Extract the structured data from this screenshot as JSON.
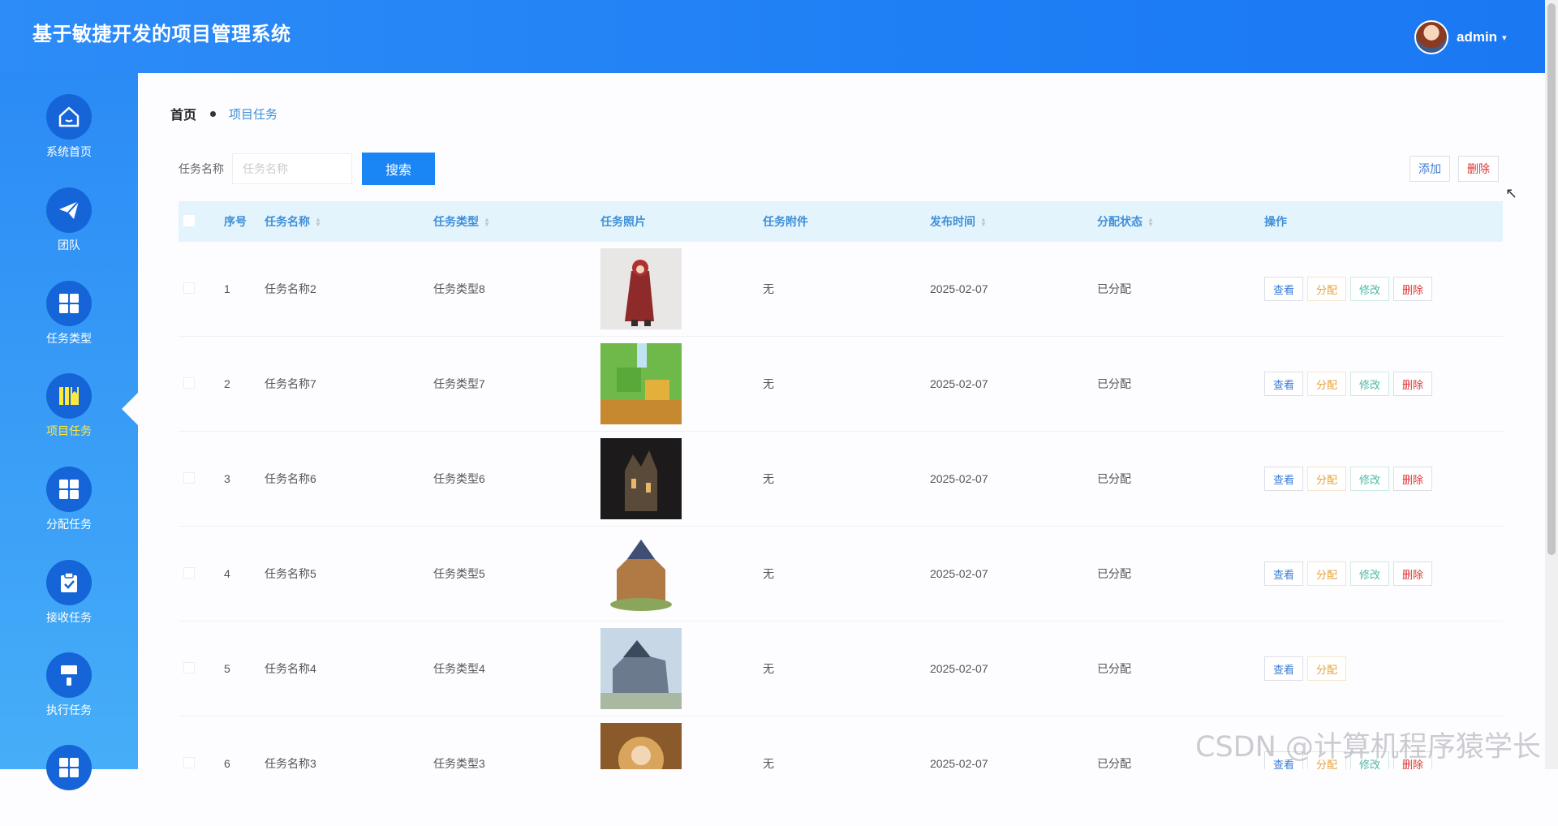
{
  "header": {
    "title": "基于敏捷开发的项目管理系统",
    "username": "admin",
    "caret": "▾"
  },
  "sidebar": {
    "items": [
      {
        "label": "系统首页",
        "icon": "home-icon"
      },
      {
        "label": "团队",
        "icon": "paper-plane-icon"
      },
      {
        "label": "任务类型",
        "icon": "grid-icon"
      },
      {
        "label": "项目任务",
        "icon": "book-icon",
        "active": true
      },
      {
        "label": "分配任务",
        "icon": "grid-icon"
      },
      {
        "label": "接收任务",
        "icon": "clipboard-check-icon"
      },
      {
        "label": "执行任务",
        "icon": "brush-icon"
      },
      {
        "label": "",
        "icon": "grid-icon"
      }
    ]
  },
  "breadcrumb": {
    "home": "首页",
    "current": "项目任务"
  },
  "search": {
    "label": "任务名称",
    "placeholder": "任务名称",
    "button": "搜索"
  },
  "toolbar": {
    "add_label": "添加",
    "delete_label": "删除"
  },
  "table": {
    "headers": {
      "index": "序号",
      "name": "任务名称",
      "type": "任务类型",
      "photo": "任务照片",
      "attachment": "任务附件",
      "publish_time": "发布时间",
      "status": "分配状态",
      "actions": "操作"
    },
    "action_labels": {
      "view": "查看",
      "assign": "分配",
      "edit": "修改",
      "delete": "删除"
    },
    "rows": [
      {
        "index": "1",
        "name": "任务名称2",
        "type": "任务类型8",
        "attachment": "无",
        "publish_time": "2025-02-07",
        "status": "已分配"
      },
      {
        "index": "2",
        "name": "任务名称7",
        "type": "任务类型7",
        "attachment": "无",
        "publish_time": "2025-02-07",
        "status": "已分配"
      },
      {
        "index": "3",
        "name": "任务名称6",
        "type": "任务类型6",
        "attachment": "无",
        "publish_time": "2025-02-07",
        "status": "已分配"
      },
      {
        "index": "4",
        "name": "任务名称5",
        "type": "任务类型5",
        "attachment": "无",
        "publish_time": "2025-02-07",
        "status": "已分配"
      },
      {
        "index": "5",
        "name": "任务名称4",
        "type": "任务类型4",
        "attachment": "无",
        "publish_time": "2025-02-07",
        "status": "已分配"
      },
      {
        "index": "6",
        "name": "任务名称3",
        "type": "任务类型3",
        "attachment": "无",
        "publish_time": "2025-02-07",
        "status": "已分配"
      }
    ]
  },
  "watermark": "CSDN @计算机程序猿学长",
  "colors": {
    "header": "#1e7ff5",
    "sidebar_top": "#2b8bf5",
    "sidebar_bottom": "#46aef8",
    "active_label": "#ffe93d",
    "table_header": "#e4f4fd",
    "primary": "#1a86f5"
  }
}
